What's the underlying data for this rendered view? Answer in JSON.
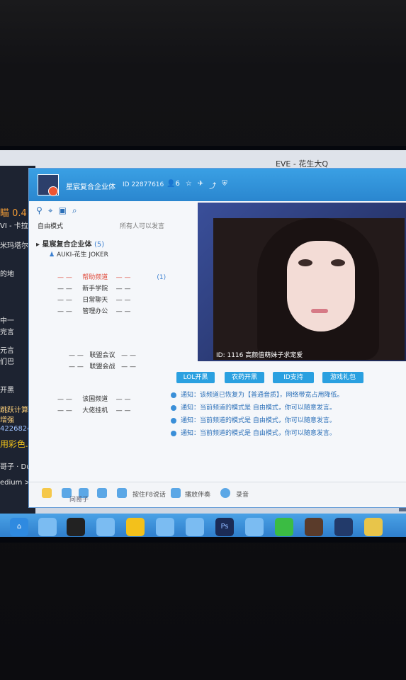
{
  "external": {
    "window_title": "EVE - 花生大Q",
    "left_panel_lines": [
      "瞄 0.4",
      "VI - 卡拉",
      "米玛塔尔",
      "的地",
      "中一",
      "完言",
      "元言",
      "们巴",
      "开黑",
      "跳跃计算器",
      "增强",
      "42268244",
      "用彩色.",
      "哥子 · Dune",
      "edium > ?"
    ]
  },
  "qtalk": {
    "channel_name": "星宸复合企业体",
    "channel_id": "ID 22877616",
    "member_count": "6",
    "tools_icons": [
      "user-icon",
      "location-icon",
      "note-icon",
      "search-icon"
    ],
    "mode_left": "自由模式",
    "mode_right": "所有人可以发言",
    "tree": {
      "root": "星宸复合企业体",
      "root_count": "(5)",
      "user": "AUKI-花生 JOKER",
      "sections": [
        {
          "label": "帮助频道",
          "count": "(1)"
        },
        {
          "label": "新手学院"
        },
        {
          "label": "日常聊天"
        },
        {
          "label": "管理办公"
        },
        {
          "label": "联盟会议"
        },
        {
          "label": "联盟会战"
        },
        {
          "label": "该国频道"
        },
        {
          "label": "大佬挂机"
        }
      ],
      "dashes": "— —"
    },
    "video_caption": "ID: 1116  高颜值萌妹子求宠爱",
    "quick_buttons": [
      "LOL开黑",
      "农药开黑",
      "ID支持",
      "游戏礼包"
    ],
    "notices": [
      "通知：该频道已恢复为【普通音质】，网络带宽占用降低。",
      "通知：当前频道的模式是 自由模式，你可以随意发言。",
      "通知：当前频道的模式是 自由模式，你可以随意发言。",
      "通知：当前频道的模式是 自由模式，你可以随意发言。"
    ],
    "bottombar": {
      "ptt": "按住F8说话",
      "music": "播放伴奏",
      "record": "录音"
    }
  },
  "desk_label": "问哥子"
}
